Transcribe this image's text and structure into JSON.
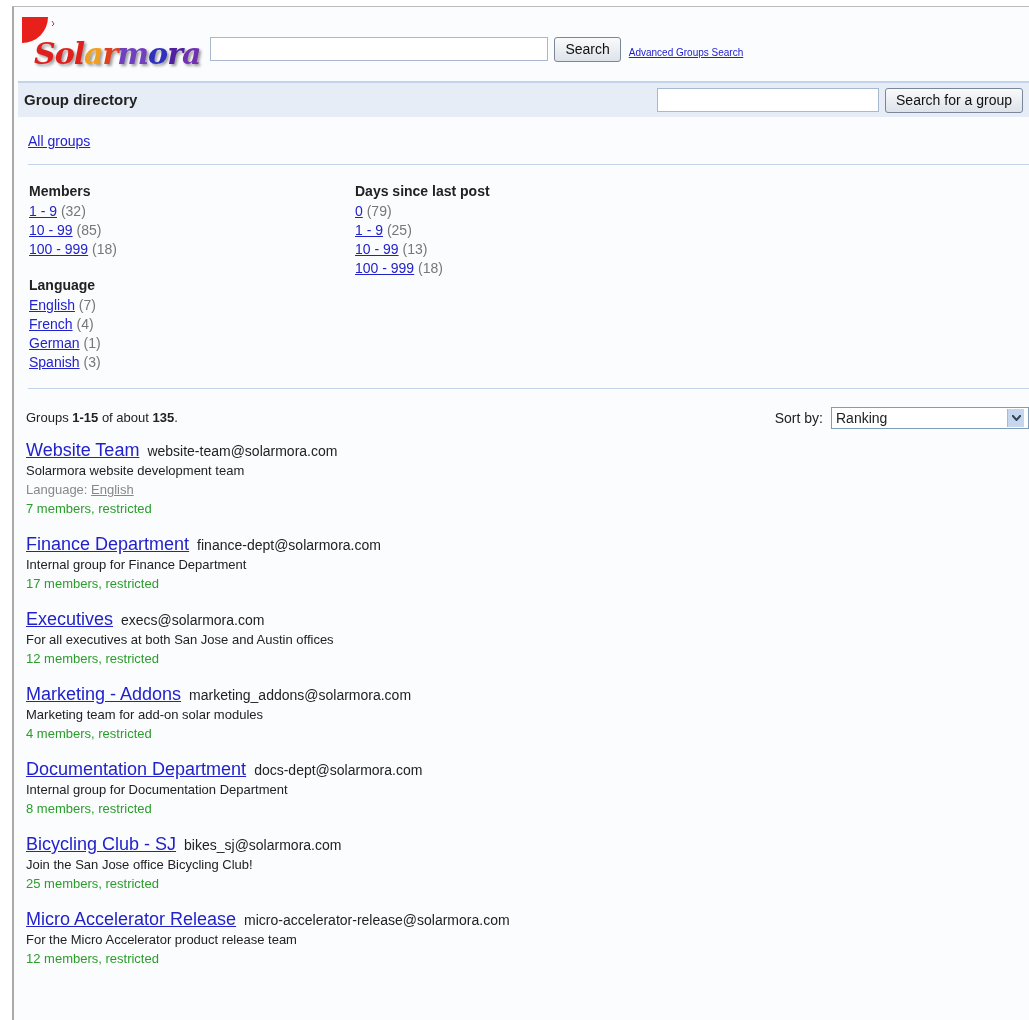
{
  "header": {
    "logo": "Solarmora",
    "search": {
      "button": "Search"
    },
    "advanced_link": "Advanced Groups Search"
  },
  "directory_bar": {
    "title": "Group directory",
    "button": "Search for a group"
  },
  "all_groups_link": "All groups",
  "filters": [
    {
      "title": "Members",
      "items": [
        {
          "label": "1 - 9",
          "count": "(32)"
        },
        {
          "label": "10 - 99",
          "count": "(85)"
        },
        {
          "label": "100 - 999",
          "count": "(18)"
        }
      ]
    },
    {
      "title": "Days since last post",
      "items": [
        {
          "label": "0",
          "count": "(79)"
        },
        {
          "label": "1 - 9",
          "count": "(25)"
        },
        {
          "label": "10 - 99",
          "count": "(13)"
        },
        {
          "label": "100 - 999",
          "count": "(18)"
        }
      ]
    },
    {
      "title": "Language",
      "items": [
        {
          "label": "English",
          "count": "(7)"
        },
        {
          "label": "French",
          "count": "(4)"
        },
        {
          "label": "German",
          "count": "(1)"
        },
        {
          "label": "Spanish",
          "count": "(3)"
        }
      ]
    }
  ],
  "results_summary": "Groups **1-15** of about **135**.",
  "sort": {
    "label": "Sort by:",
    "value": "Ranking"
  },
  "groups": [
    {
      "name": "Website Team",
      "email": "website-team@solarmora.com",
      "description": "Solarmora website development team",
      "language_label": "Language:",
      "language": "English",
      "members": "7 members, restricted"
    },
    {
      "name": "Finance Department",
      "email": "finance-dept@solarmora.com",
      "description": "Internal group for Finance Department",
      "members": "17 members, restricted"
    },
    {
      "name": "Executives",
      "email": "execs@solarmora.com",
      "description": "For all executives at both San Jose and Austin offices",
      "members": "12 members, restricted"
    },
    {
      "name": "Marketing - Addons",
      "email": "marketing_addons@solarmora.com",
      "description": "Marketing team for add-on solar modules",
      "members": "4 members, restricted"
    },
    {
      "name": "Documentation Department",
      "email": "docs-dept@solarmora.com",
      "description": "Internal group for Documentation Department",
      "members": "8 members, restricted"
    },
    {
      "name": "Bicycling Club - SJ",
      "email": "bikes_sj@solarmora.com",
      "description": "Join the San Jose office Bicycling Club!",
      "members": "25 members, restricted"
    },
    {
      "name": "Micro Accelerator Release",
      "email": "micro-accelerator-release@solarmora.com",
      "description": "For the Micro Accelerator product release team",
      "members": "12 members, restricted"
    }
  ]
}
